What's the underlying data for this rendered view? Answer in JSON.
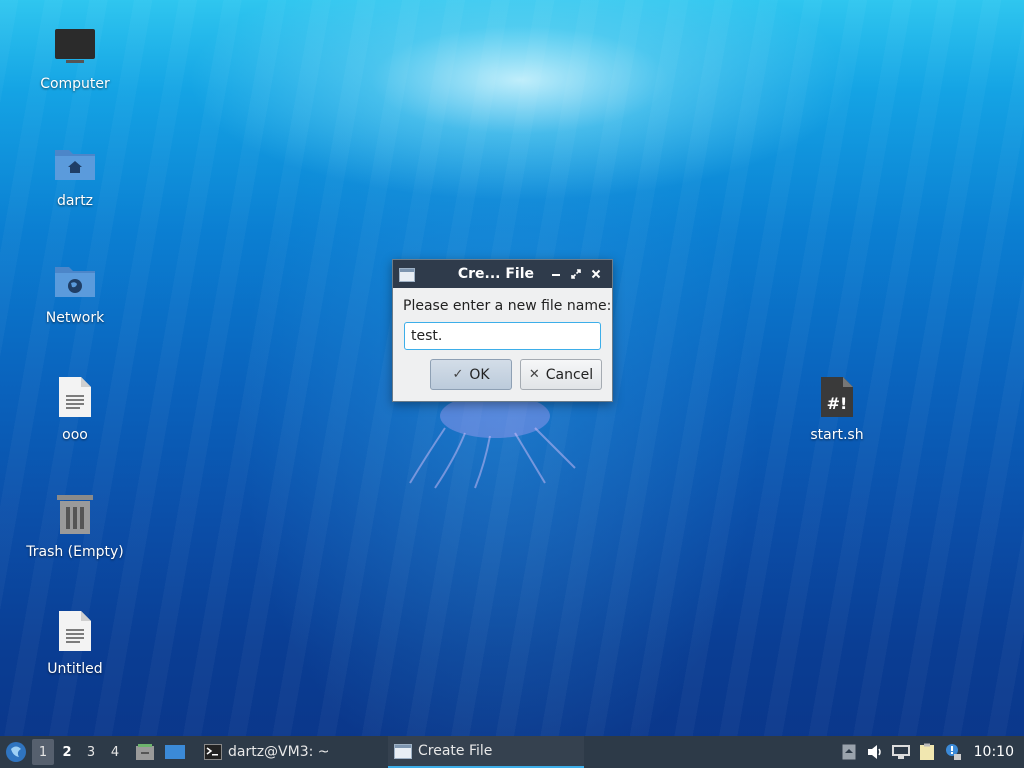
{
  "desktop": {
    "icons": [
      {
        "label": "Computer",
        "icon": "computer-icon"
      },
      {
        "label": "dartz",
        "icon": "home-folder-icon"
      },
      {
        "label": "Network",
        "icon": "network-folder-icon"
      },
      {
        "label": "ooo",
        "icon": "text-file-icon"
      },
      {
        "label": "Trash (Empty)",
        "icon": "trash-icon"
      },
      {
        "label": "Untitled",
        "icon": "text-file-icon"
      },
      {
        "label": "start.sh",
        "icon": "shell-script-icon"
      }
    ]
  },
  "dialog": {
    "title": "Cre... File",
    "prompt": "Please enter a new file name:",
    "input_value": "test.",
    "ok_label": "OK",
    "cancel_label": "Cancel"
  },
  "taskbar": {
    "workspaces": [
      "1",
      "2",
      "3",
      "4"
    ],
    "tasks": [
      {
        "label": "dartz@VM3: ~",
        "icon": "terminal-icon"
      },
      {
        "label": "Create File",
        "icon": "window-icon"
      }
    ],
    "clock": "10:10"
  },
  "colors": {
    "panel": "#2d3a48",
    "titlebar": "#2f3b4b",
    "accent": "#3daee9"
  }
}
